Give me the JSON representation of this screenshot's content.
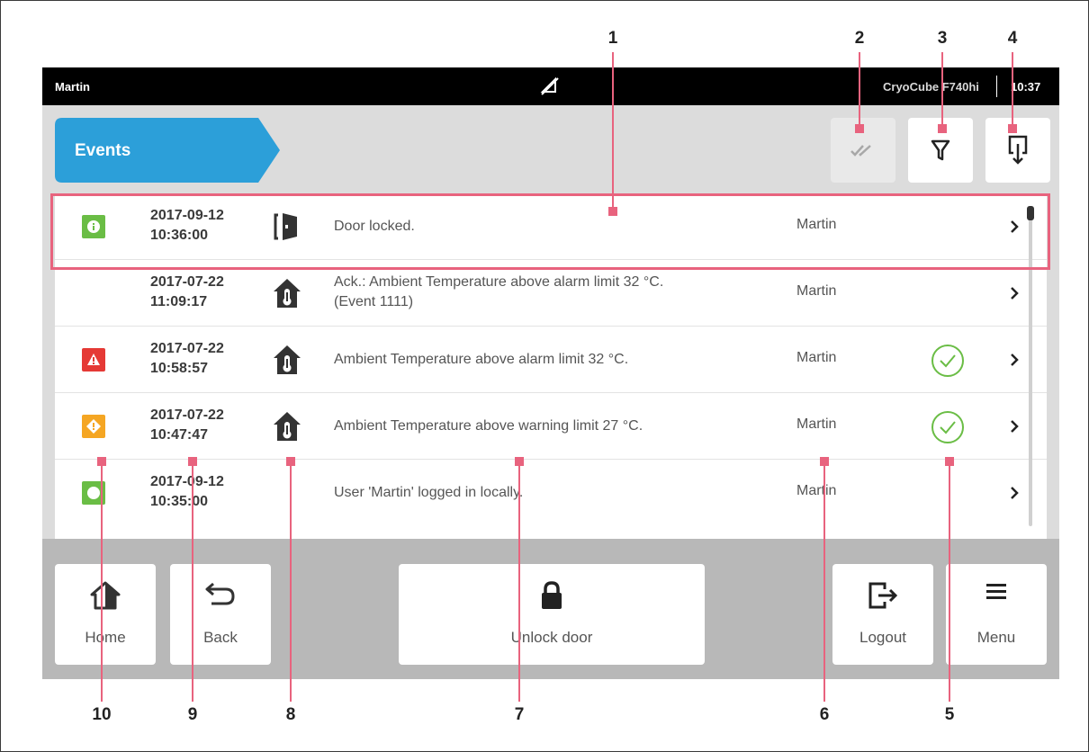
{
  "statusbar": {
    "user": "Martin",
    "device": "CryoCube F740hi",
    "time": "10:37",
    "network_icon": "network-disconnected-icon"
  },
  "header": {
    "title": "Events",
    "ack_all_icon": "double-check-icon",
    "filter_icon": "filter-icon",
    "export_icon": "export-icon"
  },
  "events": [
    {
      "severity": "info",
      "date": "2017-09-12",
      "time": "10:36:00",
      "category_icon": "door-icon",
      "message": "Door locked.",
      "message2": "",
      "user": "Martin",
      "acknowledged": false
    },
    {
      "severity": "none",
      "date": "2017-07-22",
      "time": "11:09:17",
      "category_icon": "thermometer-house-icon",
      "message": "Ack.: Ambient Temperature above alarm limit 32 °C.",
      "message2": "(Event 1111)",
      "user": "Martin",
      "acknowledged": false
    },
    {
      "severity": "alarm",
      "date": "2017-07-22",
      "time": "10:58:57",
      "category_icon": "thermometer-house-icon",
      "message": "Ambient Temperature above alarm limit 32 °C.",
      "message2": "",
      "user": "Martin",
      "acknowledged": true
    },
    {
      "severity": "warning",
      "date": "2017-07-22",
      "time": "10:47:47",
      "category_icon": "thermometer-house-icon",
      "message": "Ambient Temperature above warning limit 27 °C.",
      "message2": "",
      "user": "Martin",
      "acknowledged": true
    },
    {
      "severity": "info",
      "date": "2017-09-12",
      "time": "10:35:00",
      "category_icon": "",
      "message": "User 'Martin' logged in locally.",
      "message2": "",
      "user": "Martin",
      "acknowledged": false
    }
  ],
  "bottom": {
    "home": "Home",
    "back": "Back",
    "unlock": "Unlock door",
    "logout": "Logout",
    "menu": "Menu"
  },
  "callouts": {
    "c1": "1",
    "c2": "2",
    "c3": "3",
    "c4": "4",
    "c5": "5",
    "c6": "6",
    "c7": "7",
    "c8": "8",
    "c9": "9",
    "c10": "10"
  },
  "colors": {
    "accent": "#2c9fd9",
    "info": "#6abd45",
    "alarm": "#e53935",
    "warning": "#f5a623",
    "callout": "#e8637e"
  }
}
